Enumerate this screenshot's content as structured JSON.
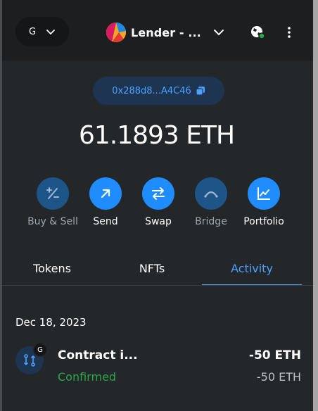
{
  "header": {
    "network_label": "G",
    "account_name": "Lender - ..."
  },
  "wallet": {
    "address": "0x288d8...A4C46",
    "balance": "61.1893 ETH"
  },
  "actions": [
    {
      "label": "Buy & Sell",
      "enabled": false,
      "icon": "plus-minus-icon"
    },
    {
      "label": "Send",
      "enabled": true,
      "icon": "arrow-up-right-icon"
    },
    {
      "label": "Swap",
      "enabled": true,
      "icon": "swap-arrows-icon"
    },
    {
      "label": "Bridge",
      "enabled": false,
      "icon": "bridge-icon"
    },
    {
      "label": "Portfolio",
      "enabled": true,
      "icon": "chart-icon"
    }
  ],
  "tabs": [
    {
      "label": "Tokens",
      "active": false
    },
    {
      "label": "NFTs",
      "active": false
    },
    {
      "label": "Activity",
      "active": true
    }
  ],
  "activity": {
    "date": "Dec 18, 2023",
    "items": [
      {
        "network_badge": "G",
        "title": "Contract i...",
        "status": "Confirmed",
        "amount": "-50 ETH",
        "fiat": "-50 ETH"
      }
    ]
  },
  "colors": {
    "accent": "#1f8dff",
    "link": "#4ea1ff",
    "success": "#28a745",
    "background": "#24272a"
  }
}
